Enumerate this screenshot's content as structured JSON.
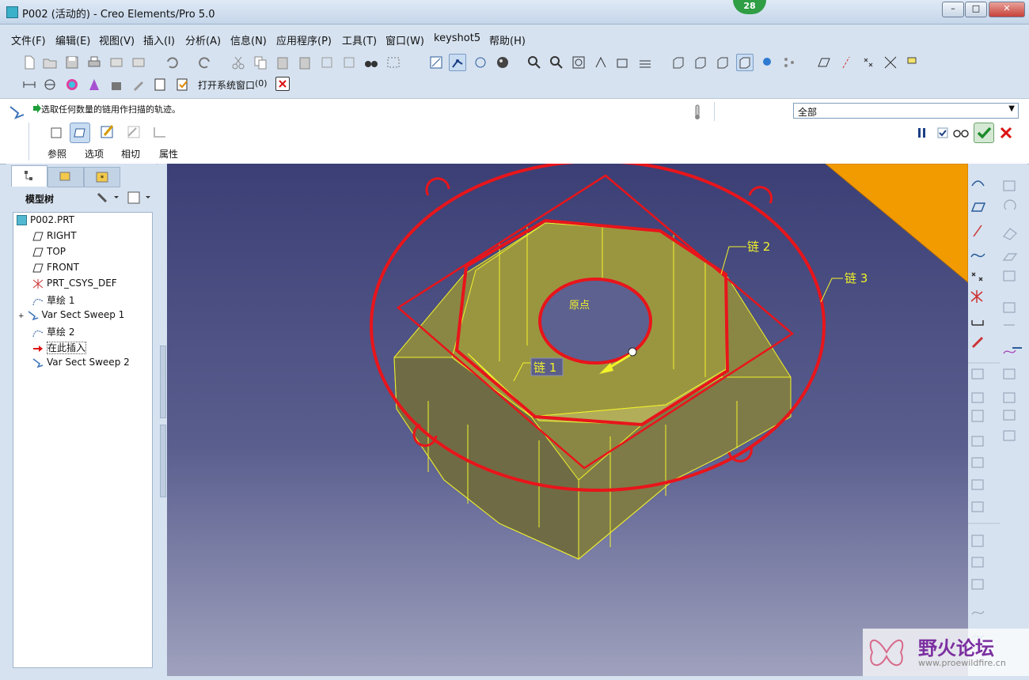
{
  "window": {
    "title": "P002 (活动的) - Creo Elements/Pro 5.0",
    "badge": "28"
  },
  "menu": [
    "文件(F)",
    "编辑(E)",
    "视图(V)",
    "插入(I)",
    "分析(A)",
    "信息(N)",
    "应用程序(P)",
    "工具(T)",
    "窗口(W)",
    "keyshot5",
    "帮助(H)"
  ],
  "toolbar2": {
    "open_system_window": "打开系统窗口",
    "count": "(0)"
  },
  "dashboard": {
    "prompt": "选取任何数量的链用作扫描的轨迹。",
    "filter": "全部",
    "tabs": [
      "参照",
      "选项",
      "相切",
      "属性"
    ]
  },
  "model_tree": {
    "title": "模型树",
    "root": "P002.PRT",
    "items": [
      "RIGHT",
      "TOP",
      "FRONT",
      "PRT_CSYS_DEF",
      "草绘 1",
      "Var Sect Sweep 1",
      "草绘 2",
      "在此插入",
      "Var Sect Sweep 2"
    ]
  },
  "viewport": {
    "labels": {
      "chain1": "链 1",
      "chain2": "链 2",
      "chain3": "链 3",
      "origin": "原点"
    }
  },
  "watermark": {
    "title": "野火论坛",
    "url": "www.proewildfire.cn"
  },
  "colors": {
    "selection": "#e8151b",
    "wire": "#f2f22a",
    "accent": "#ff9900"
  }
}
